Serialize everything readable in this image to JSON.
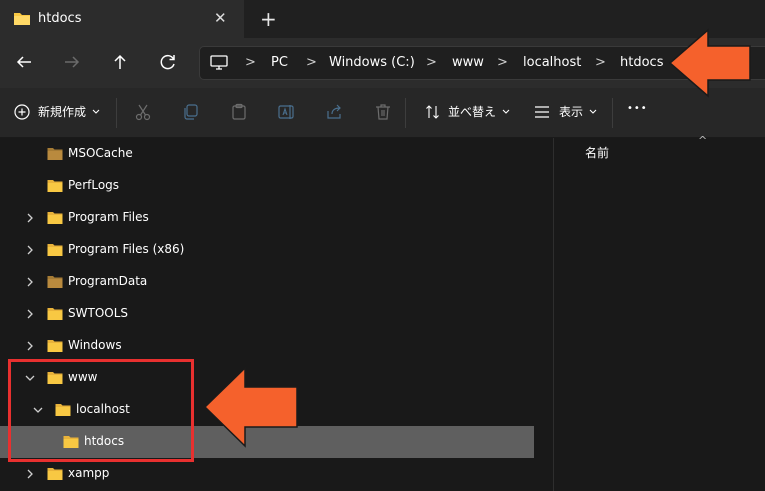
{
  "window": {
    "tab_title": "htdocs",
    "close_glyph": "✕",
    "new_tab_glyph": "+"
  },
  "nav": {
    "icons": [
      "back-arrow-icon",
      "forward-arrow-icon",
      "up-arrow-icon",
      "refresh-icon"
    ]
  },
  "breadcrumb": {
    "separator": ">",
    "items": [
      "PC",
      "Windows (C:)",
      "www",
      "localhost",
      "htdocs"
    ]
  },
  "toolbar": {
    "new_label": "新規作成",
    "sort_label": "並べ替え",
    "view_label": "表示",
    "more_label": "•••",
    "icons": [
      "cut-icon",
      "copy-icon",
      "paste-icon",
      "rename-icon",
      "share-icon",
      "delete-icon"
    ]
  },
  "tree": {
    "items": [
      {
        "label": "MSOCache",
        "expandable": false,
        "expanded": false,
        "dim": true
      },
      {
        "label": "PerfLogs",
        "expandable": false,
        "expanded": false,
        "dim": false
      },
      {
        "label": "Program Files",
        "expandable": true,
        "expanded": false,
        "dim": false
      },
      {
        "label": "Program Files (x86)",
        "expandable": true,
        "expanded": false,
        "dim": false
      },
      {
        "label": "ProgramData",
        "expandable": true,
        "expanded": false,
        "dim": true
      },
      {
        "label": "SWTOOLS",
        "expandable": true,
        "expanded": false,
        "dim": false
      },
      {
        "label": "Windows",
        "expandable": true,
        "expanded": false,
        "dim": false
      },
      {
        "label": "www",
        "expandable": true,
        "expanded": true,
        "dim": false
      },
      {
        "label": "localhost",
        "expandable": true,
        "expanded": true,
        "dim": false
      },
      {
        "label": "htdocs",
        "expandable": false,
        "expanded": false,
        "dim": false,
        "selected": true
      },
      {
        "label": "xampp",
        "expandable": true,
        "expanded": false,
        "dim": false
      }
    ]
  },
  "details": {
    "column_name": "名前",
    "sort_glyph": "^"
  },
  "colors": {
    "accent_arrow": "#f5612c",
    "highlight_box": "#e8302f",
    "folder_yellow": "#f8c843",
    "folder_dim": "#a57b35"
  }
}
